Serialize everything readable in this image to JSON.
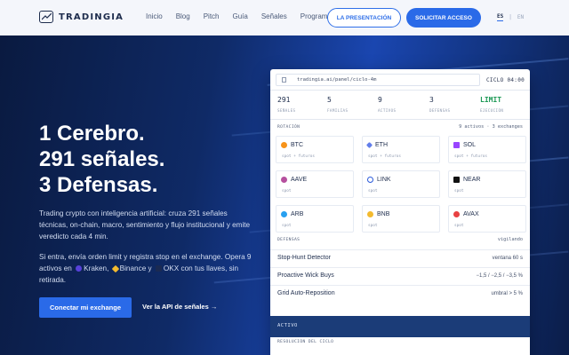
{
  "brand": {
    "name": "TRADINGIA"
  },
  "nav": {
    "links": [
      "Inicio",
      "Blog",
      "Pitch",
      "Guía",
      "Señales",
      "Programa"
    ],
    "presentation_label": "LA PRESENTACIÓN",
    "request_label": "SOLICITAR ACCESO",
    "lang_es": "ES",
    "lang_sep": "|",
    "lang_en": "EN"
  },
  "hero": {
    "title_line1": "1 Cerebro.",
    "title_line2": "291 señales.",
    "title_line3": "3 Defensas.",
    "description": "Trading crypto con inteligencia artificial: cruza 291 señales técnicas, on-chain, macro, sentimiento y flujo institucional y emite veredicto cada 4 min.",
    "desc2_part1": "Si entra, envía orden limit y registra stop en el exchange. Opera 9 activos en",
    "exchange1": "Kraken,",
    "exchange2": "Binance y",
    "exchange3": "OKX con tus llaves, sin retirada.",
    "connect_label": "Conectar mi exchange",
    "api_label": "Ver la API de señales →"
  },
  "panel": {
    "url": "tradingia.ai/panel/ciclo-4m",
    "cycle": "CICLO 04:00",
    "stats": [
      {
        "value": "291",
        "label": "SEÑALES"
      },
      {
        "value": "5",
        "label": "FAMILIAS"
      },
      {
        "value": "9",
        "label": "ACTIVOS"
      },
      {
        "value": "3",
        "label": "DEFENSAS"
      },
      {
        "value": "LIMIT",
        "label": "EJECUCIÓN"
      }
    ],
    "rotation_title": "ROTACIÓN",
    "rotation_right": "9 activos · 3 exchanges",
    "assets": [
      {
        "symbol": "BTC",
        "sub": "spot + futuros",
        "color": "#f7931a"
      },
      {
        "symbol": "ETH",
        "sub": "spot + futuros",
        "color": "#627eea"
      },
      {
        "symbol": "SOL",
        "sub": "spot + futuros",
        "color": "#9945ff"
      },
      {
        "symbol": "AAVE",
        "sub": "spot",
        "color": "#b6509e"
      },
      {
        "symbol": "LINK",
        "sub": "spot",
        "color": "#2a5ada"
      },
      {
        "symbol": "NEAR",
        "sub": "spot",
        "color": "#111111"
      },
      {
        "symbol": "ARB",
        "sub": "spot",
        "color": "#28a0f0"
      },
      {
        "symbol": "BNB",
        "sub": "spot",
        "color": "#f3ba2f"
      },
      {
        "symbol": "AVAX",
        "sub": "spot",
        "color": "#e84142"
      }
    ],
    "defenses_title": "DEFENSAS",
    "defenses_right": "vigilando",
    "defenses": [
      {
        "name": "Stop-Hunt Detector",
        "value": "ventana 60 s"
      },
      {
        "name": "Proactive Wick Buys",
        "value": "−1,5 / −2,5 / −3,5 %"
      },
      {
        "name": "Grid Auto-Reposition",
        "value": "umbral > 5 %"
      }
    ],
    "active_label": "ACTIVO",
    "resolution_label": "RESOLUCIÓN DEL CICLO"
  }
}
